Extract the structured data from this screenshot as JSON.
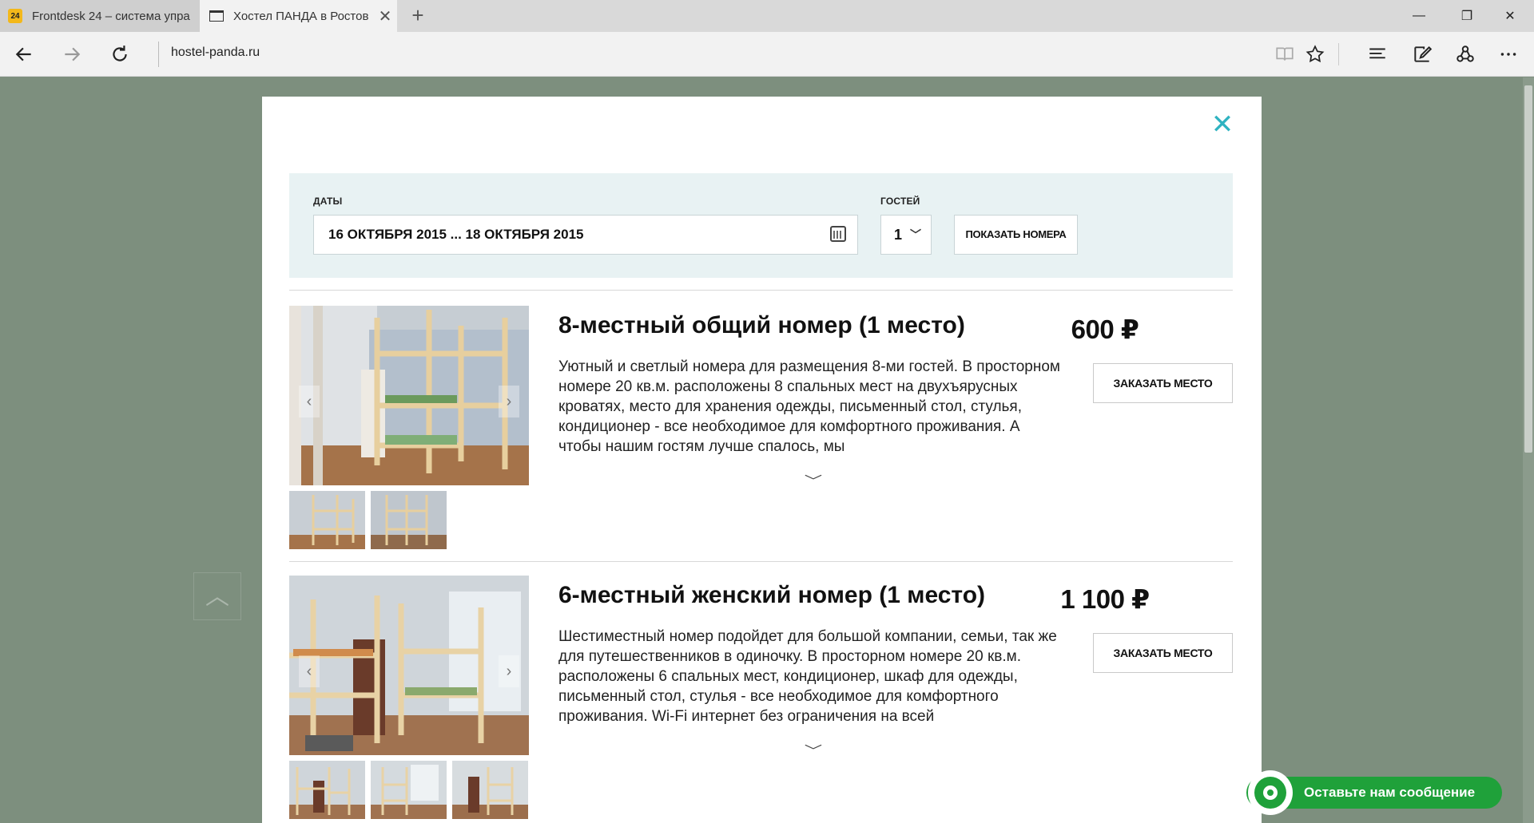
{
  "browser": {
    "tabs": [
      {
        "title": "Frontdesk 24 – система упра",
        "favicon": "24"
      },
      {
        "title": "Хостел ПАНДА в Ростов",
        "active": true
      }
    ],
    "address": "hostel-panda.ru"
  },
  "search": {
    "dates_label": "ДАТЫ",
    "dates_value": "16 ОКТЯБРЯ 2015 ... 18 ОКТЯБРЯ 2015",
    "guests_label": "ГОСТЕЙ",
    "guests_value": "1",
    "show_button": "ПОКАЗАТЬ НОМЕРА"
  },
  "rooms": [
    {
      "title": "8-местный общий номер (1 место)",
      "description": "Уютный и светлый номера для размещения 8-ми гостей. В просторном номере 20 кв.м. расположены 8 спальных мест на двухъярусных кроватях, место для хранения одежды, письменный стол, стулья, кондиционер - все необходимое для комфортного проживания. А чтобы нашим гостям лучше спалось, мы",
      "price": "600 ₽",
      "book_button": "ЗАКАЗАТЬ МЕСТО"
    },
    {
      "title": "6-местный женский номер (1 место)",
      "description": "Шестиместный номер подойдет для большой компании, семьи, так же для путешественников в одиночку. В просторном номере 20 кв.м. расположены 6 спальных мест, кондиционер, шкаф для одежды, письменный стол, стулья - все необходимое для комфортного проживания. Wi-Fi интернет без ограничения на всей",
      "price": "1 100 ₽",
      "book_button": "ЗАКАЗАТЬ МЕСТО"
    }
  ],
  "chat": {
    "label": "Оставьте нам сообщение"
  },
  "colors": {
    "accent": "#2fb3c1",
    "chat": "#1fa13a",
    "panel": "#e8f2f3",
    "backdrop": "#7d8f7e"
  }
}
